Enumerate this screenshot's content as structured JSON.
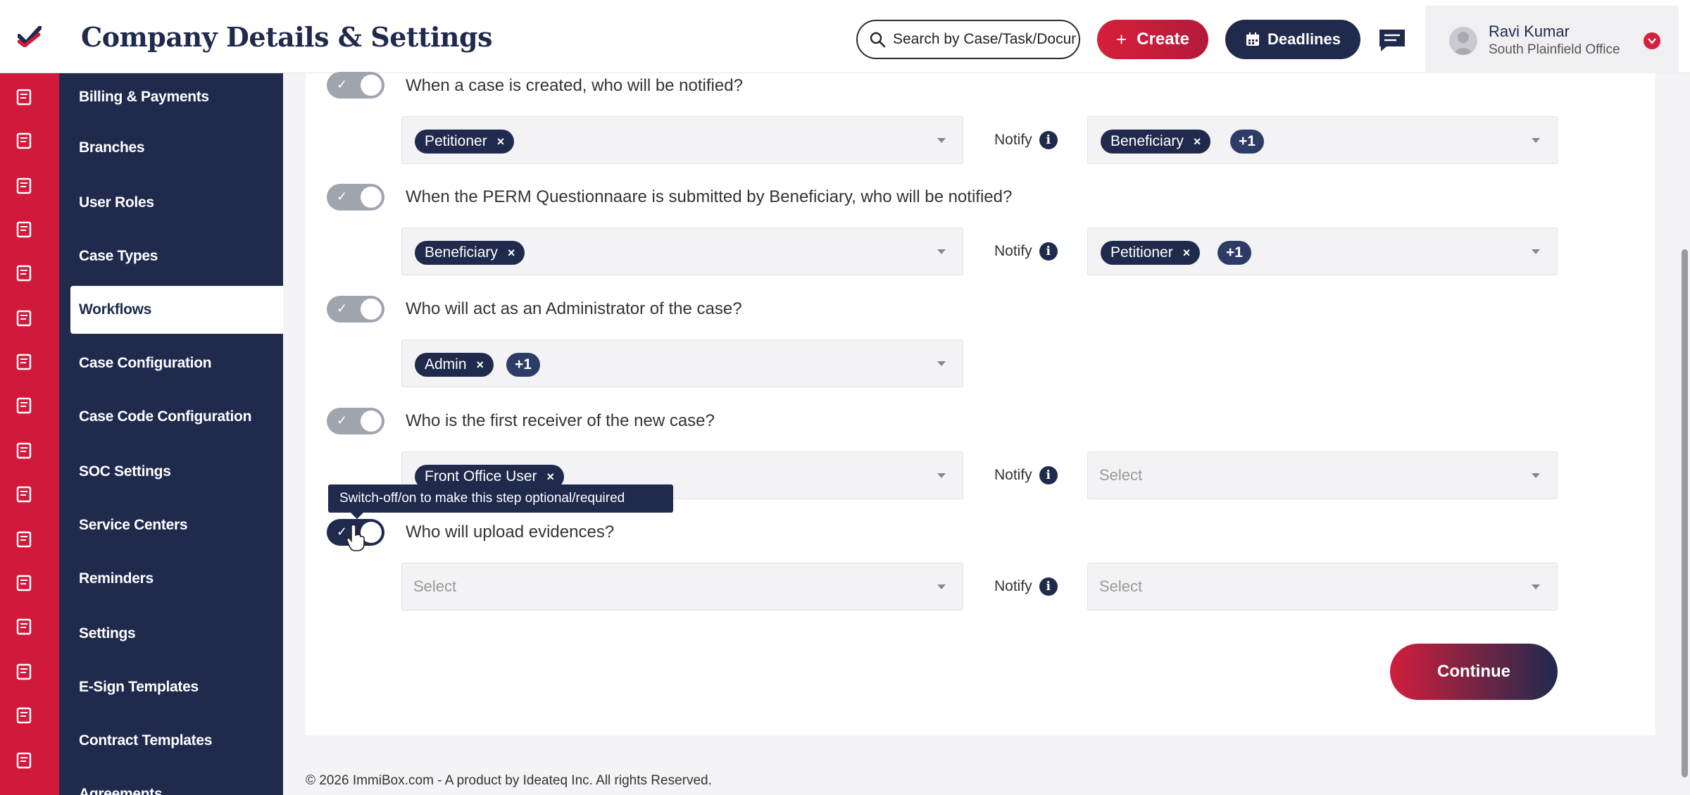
{
  "header": {
    "title": "Company Details & Settings",
    "search_placeholder": "Search by Case/Task/Document",
    "create_label": "Create",
    "deadlines_label": "Deadlines"
  },
  "user": {
    "name": "Ravi Kumar",
    "office": "South Plainfield Office"
  },
  "rail_icons": [
    "dashboard-icon",
    "clipboard-icon",
    "document-icon",
    "building-icon",
    "file-check-icon",
    "chat-icon",
    "receipt-icon",
    "edit-document-icon",
    "org-icon",
    "badge-icon",
    "person-icon",
    "user-tie-icon",
    "folder-icon",
    "note-icon",
    "support-agent-icon",
    "invoice-icon"
  ],
  "sidebar": {
    "items": [
      {
        "label": "Billing & Payments"
      },
      {
        "label": "Branches"
      },
      {
        "label": "User Roles"
      },
      {
        "label": "Case Types"
      },
      {
        "label": "Workflows",
        "active": true
      },
      {
        "label": "Case Configuration"
      },
      {
        "label": "Case Code Configuration"
      },
      {
        "label": "SOC Settings"
      },
      {
        "label": "Service Centers"
      },
      {
        "label": "Reminders"
      },
      {
        "label": "Settings"
      },
      {
        "label": "E-Sign Templates"
      },
      {
        "label": "Contract Templates"
      },
      {
        "label": "Agreements"
      }
    ]
  },
  "workflow": {
    "notify_label": "Notify",
    "select_placeholder": "Select",
    "steps": [
      {
        "question": "When a case is created, who will be notified?",
        "enabled": true,
        "chips": [
          "Petitioner"
        ],
        "notify_chips": [
          "Beneficiary"
        ],
        "notify_more": "+1"
      },
      {
        "question": "When the PERM Questionnaare is submitted by Beneficiary, who will be notified?",
        "enabled": true,
        "chips": [
          "Beneficiary"
        ],
        "notify_chips": [
          "Petitioner"
        ],
        "notify_more": "+1"
      },
      {
        "question": "Who will act as an Administrator of the case?",
        "enabled": true,
        "chips": [
          "Admin"
        ],
        "more": "+1"
      },
      {
        "question": "Who is the first receiver of the new case?",
        "enabled": true,
        "chips": [
          "Front Office User"
        ],
        "notify_placeholder": "Select"
      },
      {
        "question": "Who will upload evidences?",
        "enabled": true,
        "placeholder": "Select",
        "notify_placeholder": "Select"
      }
    ],
    "tooltip": "Switch-off/on to make this step optional/required",
    "continue_label": "Continue"
  },
  "footer": {
    "text": "© 2026 ImmiBox.com - A product by Ideateq Inc. All rights Reserved."
  },
  "colors": {
    "navy": "#1f2a4d",
    "red": "#d0193b"
  }
}
